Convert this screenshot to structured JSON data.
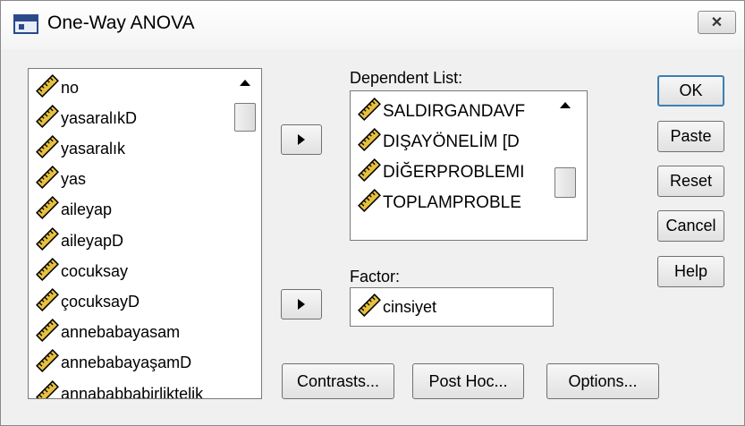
{
  "window": {
    "title": "One-Way ANOVA",
    "close_label": "✕"
  },
  "variables": {
    "items": [
      {
        "label": "no"
      },
      {
        "label": "yasaralıkD"
      },
      {
        "label": "yasaralık"
      },
      {
        "label": "yas"
      },
      {
        "label": "aileyap"
      },
      {
        "label": "aileyapD"
      },
      {
        "label": "cocuksay"
      },
      {
        "label": "çocuksayD"
      },
      {
        "label": "annebabayasam"
      },
      {
        "label": "annebabayaşamD"
      },
      {
        "label": "annababbabirliktelik"
      }
    ]
  },
  "dependent": {
    "label": "Dependent List:",
    "items": [
      {
        "label": "SALDIRGANDAVF"
      },
      {
        "label": "DIŞAYÖNELİM [D"
      },
      {
        "label": "DİĞERPROBLEMI"
      },
      {
        "label": "TOPLAMPROBLE"
      }
    ]
  },
  "factor": {
    "label": "Factor:",
    "value": "cinsiyet"
  },
  "buttons": {
    "ok": "OK",
    "paste": "Paste",
    "reset": "Reset",
    "cancel": "Cancel",
    "help": "Help",
    "contrasts": "Contrasts...",
    "post_hoc": "Post Hoc...",
    "options": "Options..."
  },
  "icons": {
    "variable": "ruler-icon",
    "app": "spss-dialog-icon"
  },
  "colors": {
    "ruler_fill": "#e8c040",
    "ruler_stroke": "#000000",
    "default_button_border": "#3c7fb1"
  }
}
